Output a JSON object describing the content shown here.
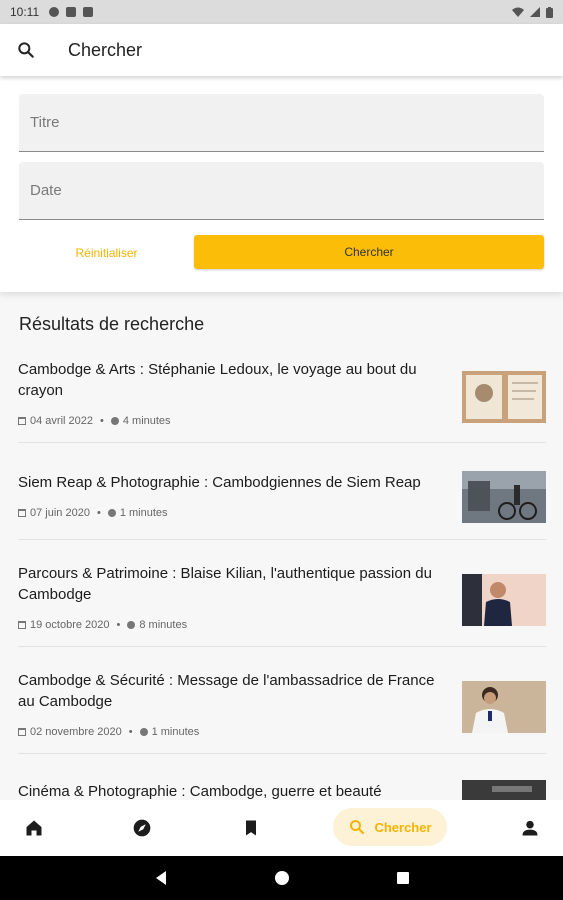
{
  "status_bar": {
    "time": "10:11"
  },
  "header": {
    "title": "Chercher"
  },
  "form": {
    "title_placeholder": "Titre",
    "date_placeholder": "Date",
    "reset_label": "Réinitialiser",
    "search_label": "Chercher"
  },
  "results": {
    "heading": "Résultats de recherche",
    "items": [
      {
        "title": "Cambodge & Arts : Stéphanie Ledoux, le voyage au bout du crayon",
        "date": "04 avril 2022",
        "duration": "4 minutes"
      },
      {
        "title": "Siem Reap & Photographie : Cambodgiennes de Siem Reap",
        "date": "07 juin 2020",
        "duration": "1 minutes"
      },
      {
        "title": "Parcours & Patrimoine : Blaise Kilian, l'authentique passion du Cambodge",
        "date": "19 octobre 2020",
        "duration": "8 minutes"
      },
      {
        "title": "Cambodge & Sécurité : Message de l'ambassadrice de France au Cambodge",
        "date": "02 novembre 2020",
        "duration": "1 minutes"
      },
      {
        "title": "Cinéma & Photographie : Cambodge, guerre et beauté"
      }
    ]
  },
  "bottom_nav": {
    "items": [
      {
        "icon": "home-icon"
      },
      {
        "icon": "compass-icon"
      },
      {
        "icon": "bookmark-icon"
      },
      {
        "icon": "search-icon",
        "label": "Chercher"
      },
      {
        "icon": "person-icon"
      }
    ]
  },
  "colors": {
    "accent": "#fbbd08",
    "accent_text": "#f5b400",
    "active_pill": "#fdf1d6"
  }
}
